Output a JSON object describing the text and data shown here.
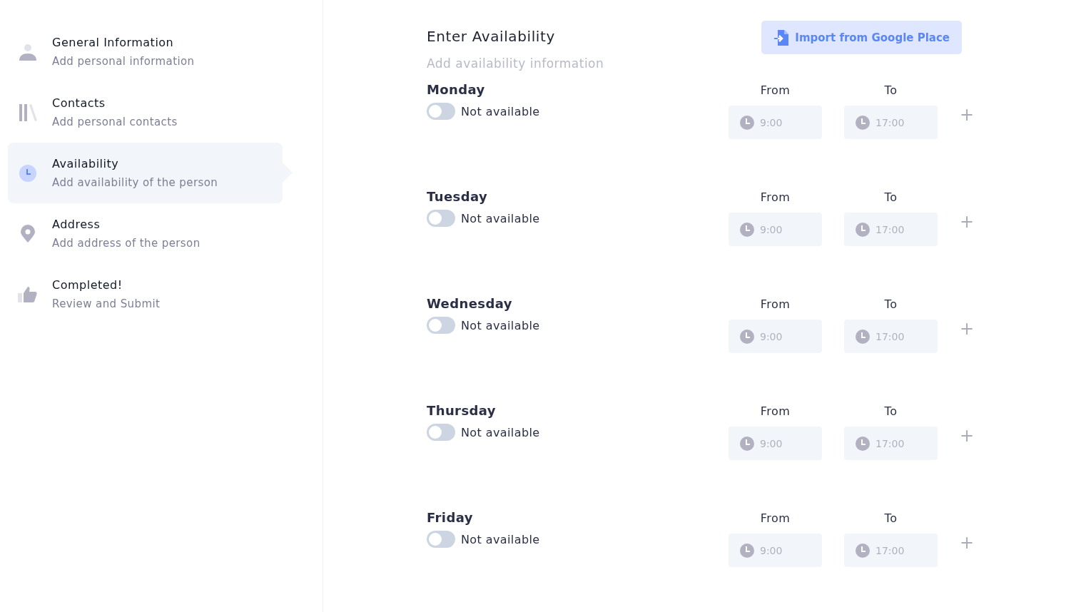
{
  "sidebar": {
    "items": [
      {
        "kind": "person",
        "title": "General Information",
        "subtitle": "Add personal information",
        "selected": false
      },
      {
        "kind": "library",
        "title": "Contacts",
        "subtitle": "Add personal contacts",
        "selected": false
      },
      {
        "kind": "clock",
        "title": "Availability",
        "subtitle": "Add availability of the person",
        "selected": true
      },
      {
        "kind": "pin",
        "title": "Address",
        "subtitle": "Add address of the person",
        "selected": false
      },
      {
        "kind": "thumb",
        "title": "Completed!",
        "subtitle": "Review and Submit",
        "selected": false
      }
    ]
  },
  "main": {
    "title": "Enter Availability",
    "subtitle": "Add availability information",
    "import_button": "Import from Google Place",
    "days": [
      {
        "name": "Monday",
        "on": false,
        "status": "Not available",
        "from_label": "From",
        "from_value": "9:00",
        "to_label": "To",
        "to_value": "17:00",
        "add": "+"
      },
      {
        "name": "Tuesday",
        "on": false,
        "status": "Not available",
        "from_label": "From",
        "from_value": "9:00",
        "to_label": "To",
        "to_value": "17:00",
        "add": "+"
      },
      {
        "name": "Wednesday",
        "on": false,
        "status": "Not available",
        "from_label": "From",
        "from_value": "9:00",
        "to_label": "To",
        "to_value": "17:00",
        "add": "+"
      },
      {
        "name": "Thursday",
        "on": false,
        "status": "Not available",
        "from_label": "From",
        "from_value": "9:00",
        "to_label": "To",
        "to_value": "17:00",
        "add": "+"
      },
      {
        "name": "Friday",
        "on": false,
        "status": "Not available",
        "from_label": "From",
        "from_value": "9:00",
        "to_label": "To",
        "to_value": "17:00",
        "add": "+"
      }
    ]
  }
}
